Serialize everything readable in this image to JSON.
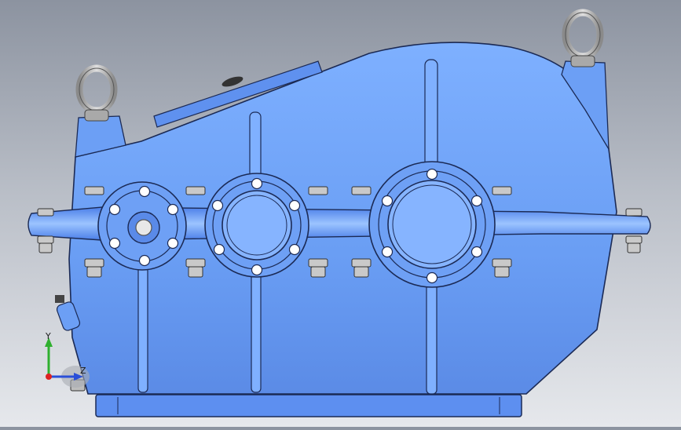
{
  "viewport": {
    "model": "gearbox-housing",
    "background_top": "#8c93a0",
    "background_bottom": "#e6e8ec",
    "housing_color": "#6ea0f5",
    "housing_shadow": "#3d68c9",
    "edge_color": "#1b2a55",
    "eyebolt_color": "#bfbfbf"
  },
  "triad": {
    "y_label": "Y",
    "z_label": "Z",
    "y_color": "#2fb02f",
    "x_color": "#d22",
    "z_color": "#2b4fd8"
  }
}
